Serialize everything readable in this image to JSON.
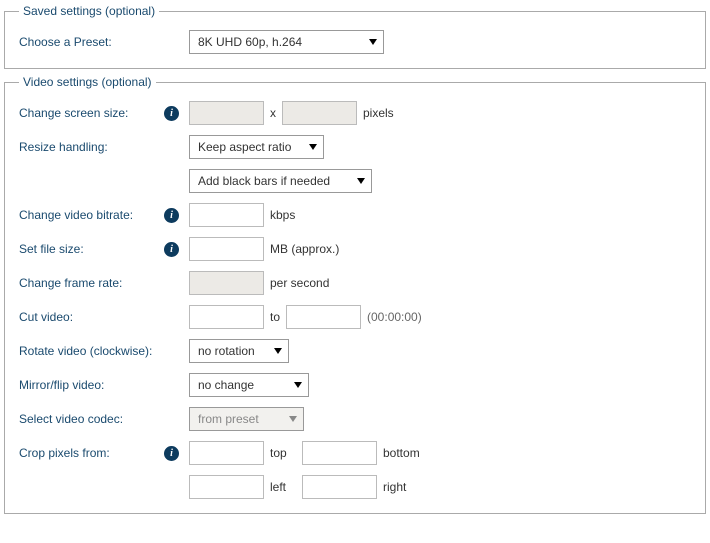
{
  "saved": {
    "legend": "Saved settings (optional)",
    "choose_preset_label": "Choose a Preset:",
    "preset_value": "8K UHD 60p, h.264"
  },
  "video": {
    "legend": "Video settings (optional)",
    "screen_size": {
      "label": "Change screen size:",
      "width": "",
      "sep": "x",
      "height": "",
      "unit": "pixels"
    },
    "resize": {
      "label": "Resize handling:",
      "aspect_value": "Keep aspect ratio",
      "bars_value": "Add black bars if needed"
    },
    "bitrate": {
      "label": "Change video bitrate:",
      "value": "",
      "unit": "kbps"
    },
    "filesize": {
      "label": "Set file size:",
      "value": "",
      "unit": "MB (approx.)"
    },
    "framerate": {
      "label": "Change frame rate:",
      "value": "",
      "unit": "per second"
    },
    "cut": {
      "label": "Cut video:",
      "from": "",
      "to_label": "to",
      "to": "",
      "hint": "(00:00:00)"
    },
    "rotate": {
      "label": "Rotate video (clockwise):",
      "value": "no rotation"
    },
    "mirror": {
      "label": "Mirror/flip video:",
      "value": "no change"
    },
    "codec": {
      "label": "Select video codec:",
      "value": "from preset"
    },
    "crop": {
      "label": "Crop pixels from:",
      "top": "",
      "top_label": "top",
      "bottom": "",
      "bottom_label": "bottom",
      "left": "",
      "left_label": "left",
      "right": "",
      "right_label": "right"
    }
  }
}
